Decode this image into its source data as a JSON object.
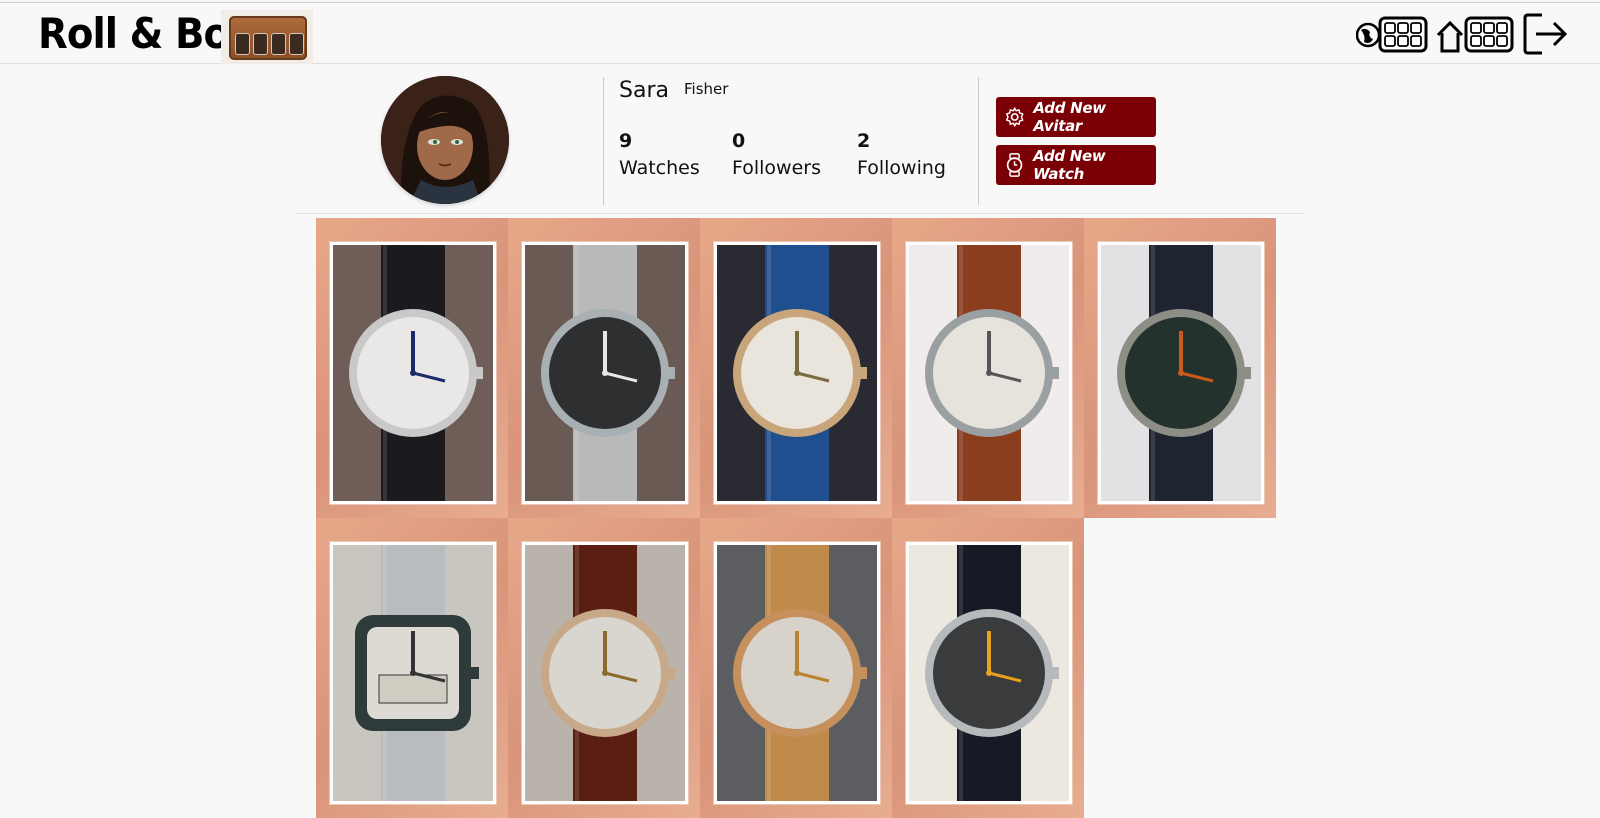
{
  "header": {
    "logo_text": "Roll & Box",
    "nav_icons": [
      "globe-collection-icon",
      "home-collection-icon",
      "logout-icon"
    ]
  },
  "profile": {
    "first_name": "Sara",
    "last_name": "Fisher",
    "stats": [
      {
        "value": "9",
        "label": "Watches"
      },
      {
        "value": "0",
        "label": "Followers"
      },
      {
        "value": "2",
        "label": "Following"
      }
    ],
    "buttons": {
      "add_avatar": "Add New Avitar",
      "add_watch": "Add New Watch"
    }
  },
  "colors": {
    "button_bg": "#7a0006",
    "tile_wood": "#e3a184",
    "page_bg": "#f8f8f8"
  },
  "watches": [
    {
      "strap": "#1b1b1f",
      "dial": "#e9e8e6",
      "case": "#c9c9c9",
      "bg": "#6f5d58",
      "hand": "#1c2a6a"
    },
    {
      "strap": "#b9b9b9",
      "dial": "#2d2f30",
      "case": "#a9b0b4",
      "bg": "#6a5a54",
      "hand": "#e8e8e8"
    },
    {
      "strap": "#1f4f8e",
      "dial": "#e9e4dc",
      "case": "#c8a57a",
      "bg": "#2a2a32",
      "hand": "#7a6a40"
    },
    {
      "strap": "#8a3e1e",
      "dial": "#e6e3dc",
      "case": "#9aa0a2",
      "bg": "#efeceb",
      "hand": "#555"
    },
    {
      "strap": "#1e2430",
      "dial": "#23322c",
      "case": "#8d8f86",
      "bg": "#e3e1e3",
      "hand": "#c85a1c"
    },
    {
      "strap": "#b9bcbe",
      "dial": "#dcdad2",
      "case": "#2f3b3a",
      "bg": "#c9c6c0",
      "hand": "#333"
    },
    {
      "strap": "#5a1e12",
      "dial": "#d8d6cf",
      "case": "#c7a98a",
      "bg": "#b9b3ab",
      "hand": "#8b6a2c"
    },
    {
      "strap": "#c08a4a",
      "dial": "#d7d3cb",
      "case": "#c5905c",
      "bg": "#5c5d60",
      "hand": "#b8822e"
    },
    {
      "strap": "#151a24",
      "dial": "#3a3b3d",
      "case": "#b7babc",
      "bg": "#ede8df",
      "hand": "#e8a21c"
    }
  ]
}
